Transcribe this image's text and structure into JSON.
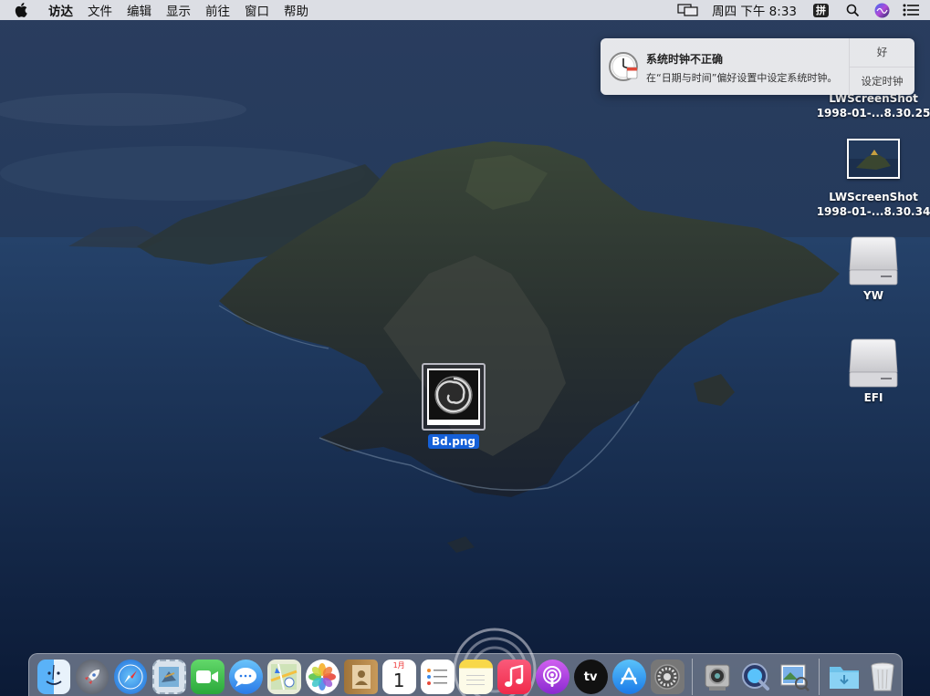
{
  "menubar": {
    "app_name": "访达",
    "menus": [
      "文件",
      "编辑",
      "显示",
      "前往",
      "窗口",
      "帮助"
    ],
    "clock": "周四 下午 8:33",
    "ime_label": "拼",
    "icons": [
      "apple-icon",
      "display-mirroring-icon",
      "input-method-icon",
      "spotlight-search-icon",
      "siri-icon",
      "notification-center-icon"
    ]
  },
  "notification": {
    "title": "系统时钟不正确",
    "message": "在“日期与时间”偏好设置中设定系统时钟。",
    "ok_button": "好",
    "action_button": "设定时钟",
    "icon": "clock-icon"
  },
  "desktop": {
    "items": [
      {
        "line1": "LWScreenShot",
        "line2": "1998-01-...8.30.25",
        "icon": "screenshot-thumbnail"
      },
      {
        "line1": "LWScreenShot",
        "line2": "1998-01-...8.30.34",
        "icon": "screenshot-thumbnail"
      },
      {
        "line1": "YW",
        "icon": "disk-drive-icon"
      },
      {
        "line1": "EFI",
        "icon": "disk-drive-icon"
      }
    ],
    "selected_file": {
      "name": "Bd.png",
      "icon": "spiral-image-icon"
    }
  },
  "dock": {
    "apps": [
      {
        "name": "finder",
        "icon": "finder-icon"
      },
      {
        "name": "launchpad",
        "icon": "rocket-icon"
      },
      {
        "name": "safari",
        "icon": "compass-icon"
      },
      {
        "name": "mail",
        "icon": "stamp-icon"
      },
      {
        "name": "facetime",
        "icon": "video-camera-icon"
      },
      {
        "name": "messages",
        "icon": "chat-bubble-icon"
      },
      {
        "name": "maps",
        "icon": "map-icon"
      },
      {
        "name": "photos",
        "icon": "flower-icon"
      },
      {
        "name": "contacts",
        "icon": "contacts-book-icon"
      },
      {
        "name": "calendar",
        "icon": "calendar-icon",
        "month": "1月",
        "day": "1"
      },
      {
        "name": "reminders",
        "icon": "checklist-icon"
      },
      {
        "name": "notes",
        "icon": "notes-icon"
      },
      {
        "name": "music",
        "icon": "music-note-icon"
      },
      {
        "name": "podcasts",
        "icon": "podcast-icon"
      },
      {
        "name": "tv",
        "icon": "apple-tv-icon",
        "label": "tv"
      },
      {
        "name": "app-store",
        "icon": "app-store-icon"
      },
      {
        "name": "system-preferences",
        "icon": "gear-icon"
      },
      {
        "name": "screenshot",
        "icon": "camera-icon"
      },
      {
        "name": "quicktime",
        "icon": "quicktime-icon"
      },
      {
        "name": "preview",
        "icon": "preview-icon"
      },
      {
        "name": "downloads",
        "icon": "downloads-folder-icon"
      },
      {
        "name": "trash",
        "icon": "trash-icon"
      }
    ]
  },
  "colors": {
    "selection_blue": "#1560d8",
    "notification_bg": "#eeeef0"
  }
}
